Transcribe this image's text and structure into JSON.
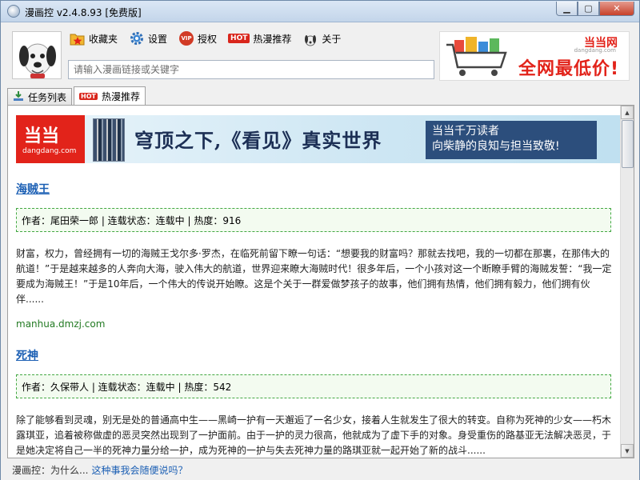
{
  "window": {
    "title": "漫画控 v2.4.8.93 [免费版]",
    "minimize_glyph": "▁",
    "maximize_glyph": "▢",
    "close_glyph": "✕"
  },
  "toolbar": {
    "items": [
      {
        "label": "收藏夹",
        "icon": "folder-star-icon"
      },
      {
        "label": "设置",
        "icon": "gear-icon"
      },
      {
        "label": "授权",
        "icon": "vip-icon",
        "badge": "VIP"
      },
      {
        "label": "热漫推荐",
        "icon": "hot-icon",
        "badge": "HOT"
      },
      {
        "label": "关于",
        "icon": "about-icon"
      }
    ]
  },
  "search": {
    "placeholder": "请输入漫画链接或关键字",
    "value": ""
  },
  "top_ad": {
    "brand": "当当网",
    "brand_sub": "dangdang.com",
    "slogan": "全网最低价!"
  },
  "tabs": [
    {
      "label": "任务列表",
      "icon": "download-icon"
    },
    {
      "label": "热漫推荐",
      "icon": "hot-icon",
      "badge": "HOT"
    }
  ],
  "banner": {
    "logo_text": "当当",
    "logo_sub": "dangdang.com",
    "headline": "穹顶之下,《看见》真实世界",
    "right_line1": "当当千万读者",
    "right_line2": "向柴静的良知与担当致敬!"
  },
  "comics": [
    {
      "title": "海贼王",
      "meta": "作者：尾田荣一郎 | 连载状态：连载中 | 热度：916",
      "description": "财富，权力，曾经拥有一切的海贼王戈尔多·罗杰，在临死前留下瞭一句话：“想要我的财富吗？那就去找吧，我的一切都在那裏，在那伟大的航道！”于是越来越多的人奔向大海，驶入伟大的航道，世界迎来瞭大海贼时代！很多年后，一个小孩对这一个断瞭手臂的海贼发誓：“我一定要成为海贼王！”于是10年后，一个伟大的传说开始瞭。这是个关于一群爱做梦孩子的故事，他们拥有热情，他们拥有毅力，他们拥有伙伴......",
      "source": "manhua.dmzj.com"
    },
    {
      "title": "死神",
      "meta": "作者：久保带人 | 连载状态：连载中 | 热度：542",
      "description": "除了能够看到灵魂，别无是处的普通高中生——黑崎一护有一天邂逅了一名少女，接着人生就发生了很大的转变。自称为死神的少女——朽木露琪亚，追着被称做虚的恶灵突然出现到了一护面前。由于一护的灵力很高，他就成为了虚下手的对象。身受重伤的路基亚无法解决恶灵，于是她决定将自己一半的死神力量分给一护，成为死神的一护与失去死神力量的路琪亚就一起开始了新的战斗......",
      "source": ""
    }
  ],
  "status": {
    "prefix": "漫画控：为什么...",
    "link": "这种事我会随便说吗？"
  },
  "colors": {
    "accent_link": "#1b5fb4",
    "hot_red": "#d9261c",
    "meta_border": "#43a843",
    "source_green": "#227a22"
  }
}
